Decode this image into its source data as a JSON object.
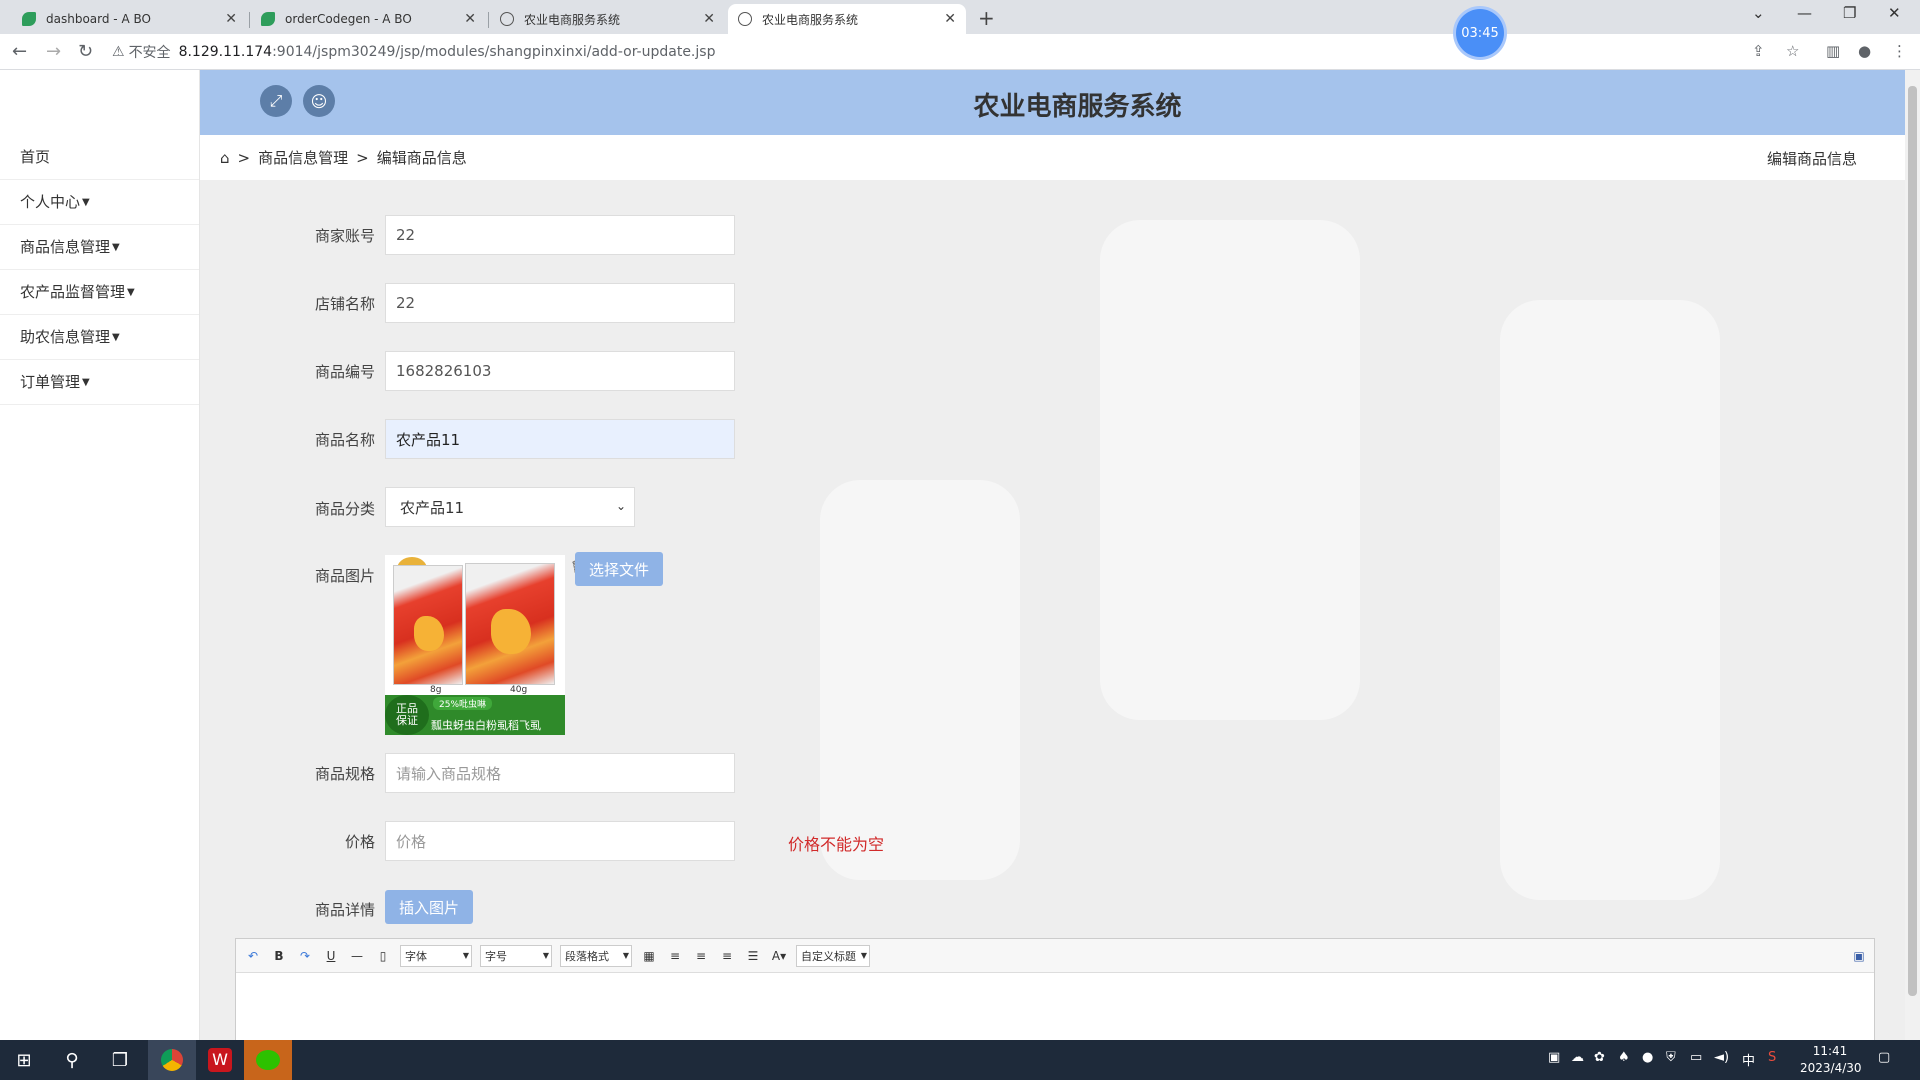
{
  "browser": {
    "tabs": [
      {
        "title": "dashboard - A BO",
        "icon": "app-leaf-icon"
      },
      {
        "title": "orderCodegen - A BO",
        "icon": "app-leaf-icon"
      },
      {
        "title": "农业电商服务系统",
        "icon": "globe-icon"
      },
      {
        "title": "农业电商服务系统",
        "icon": "globe-icon"
      }
    ],
    "insecure_label": "不安全",
    "url_host": "8.129.11.174",
    "url_path": ":9014/jspm30249/jsp/modules/shangpinxinxi/add-or-update.jsp",
    "timer": "03:45"
  },
  "header": {
    "title": "农业电商服务系统"
  },
  "sidebar": {
    "items": [
      {
        "label": "首页",
        "has_caret": false
      },
      {
        "label": "个人中心",
        "has_caret": true
      },
      {
        "label": "商品信息管理",
        "has_caret": true
      },
      {
        "label": "农产品监督管理",
        "has_caret": true
      },
      {
        "label": "助农信息管理",
        "has_caret": true
      },
      {
        "label": "订单管理",
        "has_caret": true
      }
    ]
  },
  "breadcrumb": {
    "sep": ">",
    "level1": "商品信息管理",
    "level2": "编辑商品信息",
    "right_title": "编辑商品信息"
  },
  "form": {
    "merchant_account": {
      "label": "商家账号",
      "value": "22"
    },
    "shop_name": {
      "label": "店铺名称",
      "value": "22"
    },
    "product_code": {
      "label": "商品编号",
      "value": "1682826103"
    },
    "product_name": {
      "label": "商品名称",
      "value": "农产品11"
    },
    "category": {
      "label": "商品分类",
      "value": "农产品11"
    },
    "image": {
      "label": "商品图片",
      "choose_file": "选择文件",
      "badge_line1": "正品",
      "badge_line2": "保证",
      "band_text": "瓢虫蚜虫白粉虱稻飞虱",
      "tag_text": "25%吡虫啉",
      "size_small": "8g",
      "size_large": "40g"
    },
    "spec": {
      "label": "商品规格",
      "placeholder": "请输入商品规格"
    },
    "price": {
      "label": "价格",
      "placeholder": "价格",
      "error": "价格不能为空"
    },
    "detail": {
      "label": "商品详情",
      "insert_image": "插入图片"
    }
  },
  "editor": {
    "font_label": "字体",
    "size_label": "字号",
    "paragraph_label": "段落格式",
    "custom_title_label": "自定义标题"
  },
  "taskbar": {
    "time": "11:41",
    "date": "2023/4/30",
    "ime": "中"
  }
}
